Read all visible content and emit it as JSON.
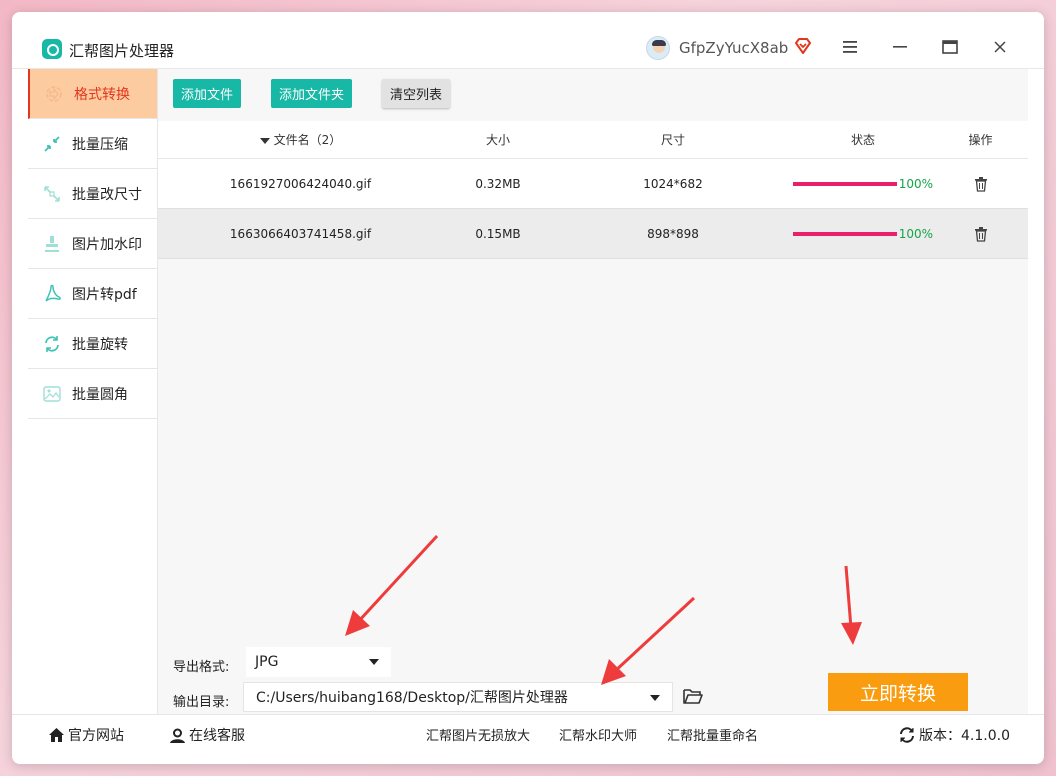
{
  "app": {
    "title": "汇帮图片处理器",
    "username": "GfpZyYucX8ab",
    "brand_color": "#17b8a6",
    "accent_color": "#e3361e"
  },
  "titlebar": {
    "menu_icon": "hamburger-icon",
    "min_icon": "minimize-icon",
    "max_icon": "maximize-icon",
    "close_icon": "close-icon",
    "vip_icon": "diamond-icon"
  },
  "sidebar": {
    "items": [
      {
        "label": "格式转换",
        "icon": "convert-icon",
        "active": true
      },
      {
        "label": "批量压缩",
        "icon": "compress-icon",
        "active": false
      },
      {
        "label": "批量改尺寸",
        "icon": "resize-icon",
        "active": false
      },
      {
        "label": "图片加水印",
        "icon": "watermark-icon",
        "active": false
      },
      {
        "label": "图片转pdf",
        "icon": "pdf-icon",
        "active": false
      },
      {
        "label": "批量旋转",
        "icon": "rotate-icon",
        "active": false
      },
      {
        "label": "批量圆角",
        "icon": "round-corner-icon",
        "active": false
      }
    ]
  },
  "toolbar": {
    "add_file": "添加文件",
    "add_folder": "添加文件夹",
    "clear_list": "清空列表"
  },
  "table": {
    "headers": {
      "name": "文件名（2）",
      "size": "大小",
      "dimensions": "尺寸",
      "status": "状态",
      "actions": "操作"
    },
    "rows": [
      {
        "name": "1661927006424040.gif",
        "size": "0.32MB",
        "dimensions": "1024*682",
        "progress": 100,
        "progress_label": "100%"
      },
      {
        "name": "1663066403741458.gif",
        "size": "0.15MB",
        "dimensions": "898*898",
        "progress": 100,
        "progress_label": "100%"
      }
    ]
  },
  "settings": {
    "format_label": "导出格式:",
    "format_value": "JPG",
    "dir_label": "输出目录:",
    "dir_value": "C:/Users/huibang168/Desktop/汇帮图片处理器",
    "convert_button": "立即转换"
  },
  "footer": {
    "website": "官方网站",
    "service": "在线客服",
    "link1": "汇帮图片无损放大",
    "link2": "汇帮水印大师",
    "link3": "汇帮批量重命名",
    "version": "版本：4.1.0.0"
  }
}
